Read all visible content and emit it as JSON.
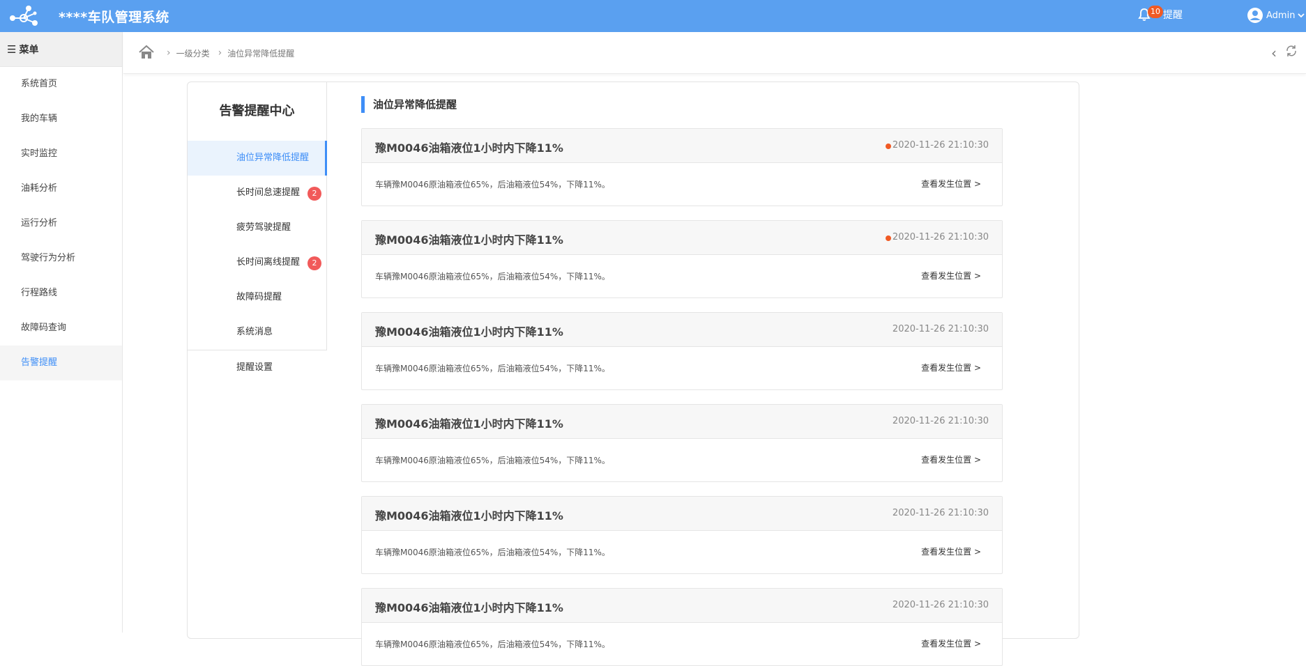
{
  "header": {
    "title": "****车队管理系统",
    "notify_count": "10",
    "notify_label": "提醒",
    "user": "Admin"
  },
  "sidebar": {
    "head": "菜单",
    "items": [
      {
        "label": "系统首页"
      },
      {
        "label": "我的车辆"
      },
      {
        "label": "实时监控"
      },
      {
        "label": "油耗分析"
      },
      {
        "label": "运行分析"
      },
      {
        "label": "驾驶行为分析"
      },
      {
        "label": "行程路线"
      },
      {
        "label": "故障码查询"
      },
      {
        "label": "告警提醒"
      }
    ],
    "active_index": 8
  },
  "breadcrumb": [
    "一级分类",
    "油位异常降低提醒"
  ],
  "subnav": {
    "title": "告警提醒中心",
    "items": [
      {
        "label": "油位异常降低提醒",
        "badge": ""
      },
      {
        "label": "长时间怠速提醒",
        "badge": "2"
      },
      {
        "label": "疲劳驾驶提醒",
        "badge": ""
      },
      {
        "label": "长时间离线提醒",
        "badge": "2"
      },
      {
        "label": "故障码提醒",
        "badge": ""
      },
      {
        "label": "系统消息",
        "badge": ""
      }
    ],
    "extra": "提醒设置"
  },
  "section_title": "油位异常降低提醒",
  "alerts": [
    {
      "title": "豫M0046油箱液位1小时内下降11%",
      "time": "2020-11-26 21:10:30",
      "unread": true,
      "desc": "车辆豫M0046原油箱液位65%，后油箱液位54%，下降11%。",
      "link": "查看发生位置 >"
    },
    {
      "title": "豫M0046油箱液位1小时内下降11%",
      "time": "2020-11-26 21:10:30",
      "unread": true,
      "desc": "车辆豫M0046原油箱液位65%，后油箱液位54%，下降11%。",
      "link": "查看发生位置 >"
    },
    {
      "title": "豫M0046油箱液位1小时内下降11%",
      "time": "2020-11-26 21:10:30",
      "unread": false,
      "desc": "车辆豫M0046原油箱液位65%，后油箱液位54%，下降11%。",
      "link": "查看发生位置 >"
    },
    {
      "title": "豫M0046油箱液位1小时内下降11%",
      "time": "2020-11-26 21:10:30",
      "unread": false,
      "desc": "车辆豫M0046原油箱液位65%，后油箱液位54%，下降11%。",
      "link": "查看发生位置 >"
    },
    {
      "title": "豫M0046油箱液位1小时内下降11%",
      "time": "2020-11-26 21:10:30",
      "unread": false,
      "desc": "车辆豫M0046原油箱液位65%，后油箱液位54%，下降11%。",
      "link": "查看发生位置 >"
    },
    {
      "title": "豫M0046油箱液位1小时内下降11%",
      "time": "2020-11-26 21:10:30",
      "unread": false,
      "desc": "车辆豫M0046原油箱液位65%，后油箱液位54%，下降11%。",
      "link": "查看发生位置 >"
    }
  ],
  "colors": {
    "header": "#5aa0f0",
    "accent": "#3e8ef7",
    "badge": "#f15a5a",
    "unread": "#f05a24"
  }
}
